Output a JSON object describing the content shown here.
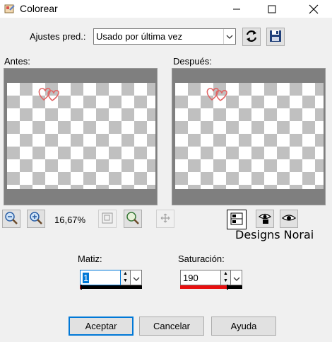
{
  "window": {
    "title": "Colorear"
  },
  "presets": {
    "label": "Ajustes pred.:",
    "value": "Usado por última vez"
  },
  "preview": {
    "before_label": "Antes:",
    "after_label": "Después:"
  },
  "zoom": {
    "level": "16,67%"
  },
  "watermark": "Designs Norai",
  "hue": {
    "label": "Matiz:",
    "value": "1",
    "fraction": 0.01,
    "bar_color": "#e81010"
  },
  "saturation": {
    "label": "Saturación:",
    "value": "190",
    "fraction": 0.75,
    "bar_color": "#e81010"
  },
  "buttons": {
    "ok": "Aceptar",
    "cancel": "Cancelar",
    "help": "Ayuda"
  },
  "colors": {
    "accent": "#0078d7",
    "heart": "#e06666"
  }
}
